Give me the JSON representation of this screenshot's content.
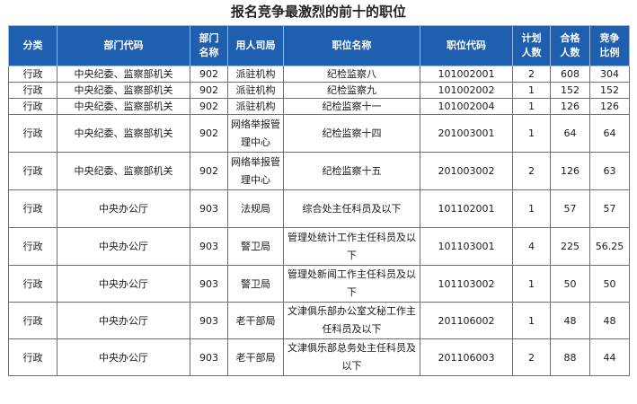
{
  "title": "报名竞争最激烈的前十的职位",
  "headers": [
    {
      "line1": "分类",
      "line2": ""
    },
    {
      "line1": "部门代码",
      "line2": ""
    },
    {
      "line1": "部门",
      "line2": "名称"
    },
    {
      "line1": "用人司局",
      "line2": ""
    },
    {
      "line1": "职位名称",
      "line2": ""
    },
    {
      "line1": "职位代码",
      "line2": ""
    },
    {
      "line1": "计划",
      "line2": "人数"
    },
    {
      "line1": "合格",
      "line2": "人数"
    },
    {
      "line1": "竞争",
      "line2": "比例"
    }
  ],
  "rows": [
    {
      "type": "行政",
      "dept": "中央纪委、监察部机关",
      "dept_code": "902",
      "bureau": "派驻机构",
      "position": "纪检监察八",
      "position_code": "101002001",
      "plan": "2",
      "qualified": "608",
      "ratio": "304"
    },
    {
      "type": "行政",
      "dept": "中央纪委、监察部机关",
      "dept_code": "902",
      "bureau": "派驻机构",
      "position": "纪检监察九",
      "position_code": "101002002",
      "plan": "1",
      "qualified": "152",
      "ratio": "152"
    },
    {
      "type": "行政",
      "dept": "中央纪委、监察部机关",
      "dept_code": "902",
      "bureau": "派驻机构",
      "position": "纪检监察十一",
      "position_code": "101002004",
      "plan": "1",
      "qualified": "126",
      "ratio": "126"
    },
    {
      "type": "行政",
      "dept": "中央纪委、监察部机关",
      "dept_code": "902",
      "bureau": "网络举报管理中心",
      "position": "纪检监察十四",
      "position_code": "201003001",
      "plan": "1",
      "qualified": "64",
      "ratio": "64"
    },
    {
      "type": "行政",
      "dept": "中央纪委、监察部机关",
      "dept_code": "902",
      "bureau": "网络举报管理中心",
      "position": "纪检监察十五",
      "position_code": "201003002",
      "plan": "2",
      "qualified": "126",
      "ratio": "63"
    },
    {
      "type": "行政",
      "dept": "中央办公厅",
      "dept_code": "903",
      "bureau": "法规局",
      "position": "综合处主任科员及以下",
      "position_code": "101102001",
      "plan": "1",
      "qualified": "57",
      "ratio": "57"
    },
    {
      "type": "行政",
      "dept": "中央办公厅",
      "dept_code": "903",
      "bureau": "警卫局",
      "position": "管理处统计工作主任科员及以下",
      "position_code": "101103001",
      "plan": "4",
      "qualified": "225",
      "ratio": "56.25"
    },
    {
      "type": "行政",
      "dept": "中央办公厅",
      "dept_code": "903",
      "bureau": "警卫局",
      "position": "管理处新闻工作主任科员及以下",
      "position_code": "101103002",
      "plan": "1",
      "qualified": "50",
      "ratio": "50"
    },
    {
      "type": "行政",
      "dept": "中央办公厅",
      "dept_code": "903",
      "bureau": "老干部局",
      "position": "文津俱乐部办公室文秘工作主任科员及以下",
      "position_code": "201106002",
      "plan": "1",
      "qualified": "48",
      "ratio": "48"
    },
    {
      "type": "行政",
      "dept": "中央办公厅",
      "dept_code": "903",
      "bureau": "老干部局",
      "position": "文津俱乐部总务处主任科员及以下",
      "position_code": "201106003",
      "plan": "2",
      "qualified": "88",
      "ratio": "44"
    }
  ]
}
